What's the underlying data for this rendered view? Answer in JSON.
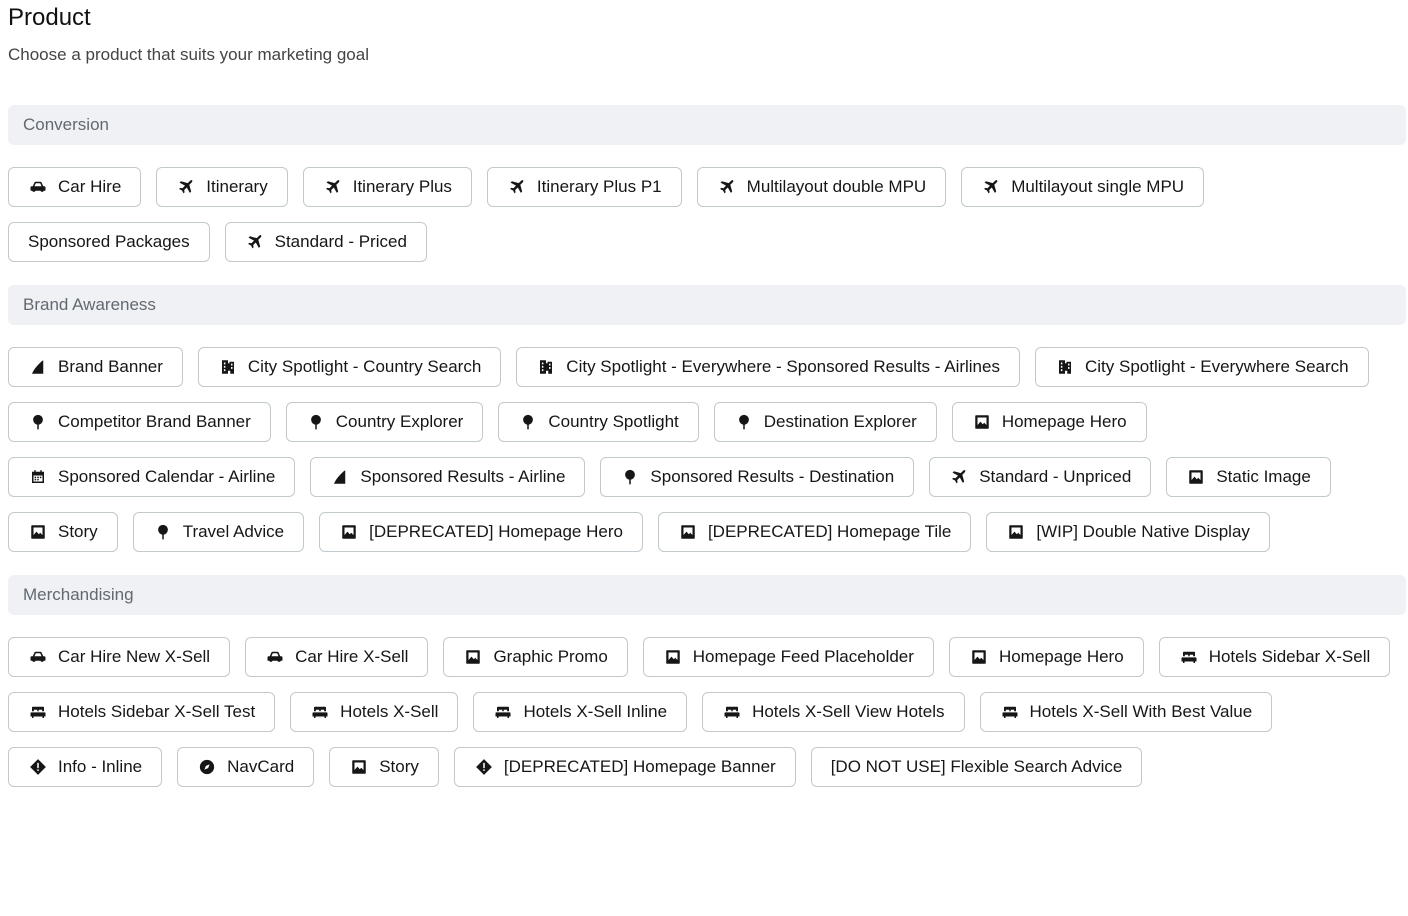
{
  "page": {
    "title": "Product",
    "subtitle": "Choose a product that suits your marketing goal"
  },
  "sections": [
    {
      "name": "Conversion",
      "items": [
        {
          "label": "Car Hire",
          "icon": "car-icon"
        },
        {
          "label": "Itinerary",
          "icon": "plane-icon"
        },
        {
          "label": "Itinerary Plus",
          "icon": "plane-icon"
        },
        {
          "label": "Itinerary Plus P1",
          "icon": "plane-icon"
        },
        {
          "label": "Multilayout double MPU",
          "icon": "plane-icon"
        },
        {
          "label": "Multilayout single MPU",
          "icon": "plane-icon"
        },
        {
          "label": "Sponsored Packages",
          "icon": ""
        },
        {
          "label": "Standard - Priced",
          "icon": "plane-icon"
        }
      ]
    },
    {
      "name": "Brand Awareness",
      "items": [
        {
          "label": "Brand Banner",
          "icon": "banner-icon"
        },
        {
          "label": "City Spotlight - Country Search",
          "icon": "city-icon"
        },
        {
          "label": "City Spotlight - Everywhere - Sponsored Results - Airlines",
          "icon": "city-icon"
        },
        {
          "label": "City Spotlight - Everywhere Search",
          "icon": "city-icon"
        },
        {
          "label": "Competitor Brand Banner",
          "icon": "pin-icon"
        },
        {
          "label": "Country Explorer",
          "icon": "pin-icon"
        },
        {
          "label": "Country Spotlight",
          "icon": "pin-icon"
        },
        {
          "label": "Destination Explorer",
          "icon": "pin-icon"
        },
        {
          "label": "Homepage Hero",
          "icon": "image-icon"
        },
        {
          "label": "Sponsored Calendar - Airline",
          "icon": "calendar-icon"
        },
        {
          "label": "Sponsored Results - Airline",
          "icon": "banner-icon"
        },
        {
          "label": "Sponsored Results - Destination",
          "icon": "pin-icon"
        },
        {
          "label": "Standard - Unpriced",
          "icon": "plane-icon"
        },
        {
          "label": "Static Image",
          "icon": "image-icon"
        },
        {
          "label": "Story",
          "icon": "image-icon"
        },
        {
          "label": "Travel Advice",
          "icon": "pin-icon"
        },
        {
          "label": "[DEPRECATED] Homepage Hero",
          "icon": "image-icon"
        },
        {
          "label": "[DEPRECATED] Homepage Tile",
          "icon": "image-icon"
        },
        {
          "label": "[WIP] Double Native Display",
          "icon": "image-icon"
        }
      ]
    },
    {
      "name": "Merchandising",
      "items": [
        {
          "label": "Car Hire New X-Sell",
          "icon": "car-icon"
        },
        {
          "label": "Car Hire X-Sell",
          "icon": "car-icon"
        },
        {
          "label": "Graphic Promo",
          "icon": "image-icon"
        },
        {
          "label": "Homepage Feed Placeholder",
          "icon": "image-icon"
        },
        {
          "label": "Homepage Hero",
          "icon": "image-icon"
        },
        {
          "label": "Hotels Sidebar X-Sell",
          "icon": "bed-icon"
        },
        {
          "label": "Hotels Sidebar X-Sell Test",
          "icon": "bed-icon"
        },
        {
          "label": "Hotels X-Sell",
          "icon": "bed-icon"
        },
        {
          "label": "Hotels X-Sell Inline",
          "icon": "bed-icon"
        },
        {
          "label": "Hotels X-Sell View Hotels",
          "icon": "bed-icon"
        },
        {
          "label": "Hotels X-Sell With Best Value",
          "icon": "bed-icon"
        },
        {
          "label": "Info - Inline",
          "icon": "info-diamond-icon"
        },
        {
          "label": "NavCard",
          "icon": "compass-icon"
        },
        {
          "label": "Story",
          "icon": "image-icon"
        },
        {
          "label": "[DEPRECATED] Homepage Banner",
          "icon": "info-diamond-icon"
        },
        {
          "label": "[DO NOT USE] Flexible Search Advice",
          "icon": ""
        }
      ]
    }
  ]
}
